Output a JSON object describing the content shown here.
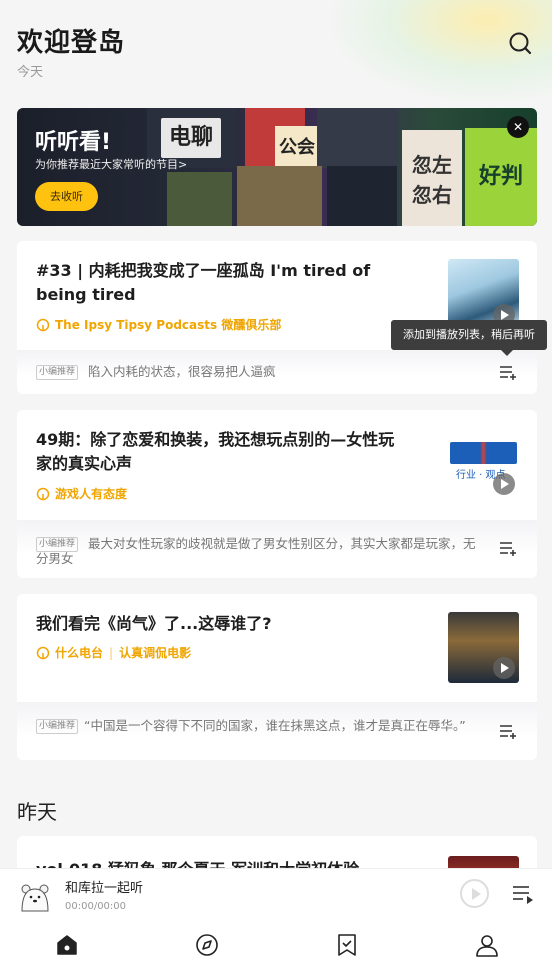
{
  "header": {
    "title": "欢迎登岛",
    "subtitle": "今天"
  },
  "banner": {
    "title": "听听看!",
    "subtitle": "为你推荐最近大家常听的节目>",
    "button": "去收听",
    "tiles": [
      "电聊",
      "公会",
      "忽左",
      "忽右",
      "好判"
    ]
  },
  "tooltip": "添加到播放列表，稍后再听",
  "badge_label": "小编推荐",
  "episodes": [
    {
      "title": "#33 | 内耗把我变成了一座孤岛 I'm tired of being tired",
      "sources": [
        "The Ipsy Tipsy Podcasts 微醺俱乐部"
      ],
      "recommendation": "陷入内耗的状态，很容易把人逼疯"
    },
    {
      "title": "49期：除了恋爱和换装，我还想玩点别的—女性玩家的真实心声",
      "sources": [
        "游戏人有态度"
      ],
      "thumb_text": "行业 · 观点",
      "recommendation": "最大对女性玩家的歧视就是做了男女性别区分，其实大家都是玩家，无分男女"
    },
    {
      "title": "我们看完《尚气》了...这辱谁了?",
      "sources": [
        "什么电台",
        "认真调侃电影"
      ],
      "recommendation": "“中国是一个容得下不同的国家，谁在抹黑这点，谁才是真正在辱华。”"
    }
  ],
  "section_yesterday": "昨天",
  "partial_episode_title": "vol.018 猛犸象 那个夏天 军训和大学初体验",
  "player": {
    "title": "和库拉一起听",
    "time": "00:00/00:00"
  },
  "tabs": [
    "home-icon",
    "discover-icon",
    "subscribe-icon",
    "profile-icon"
  ]
}
